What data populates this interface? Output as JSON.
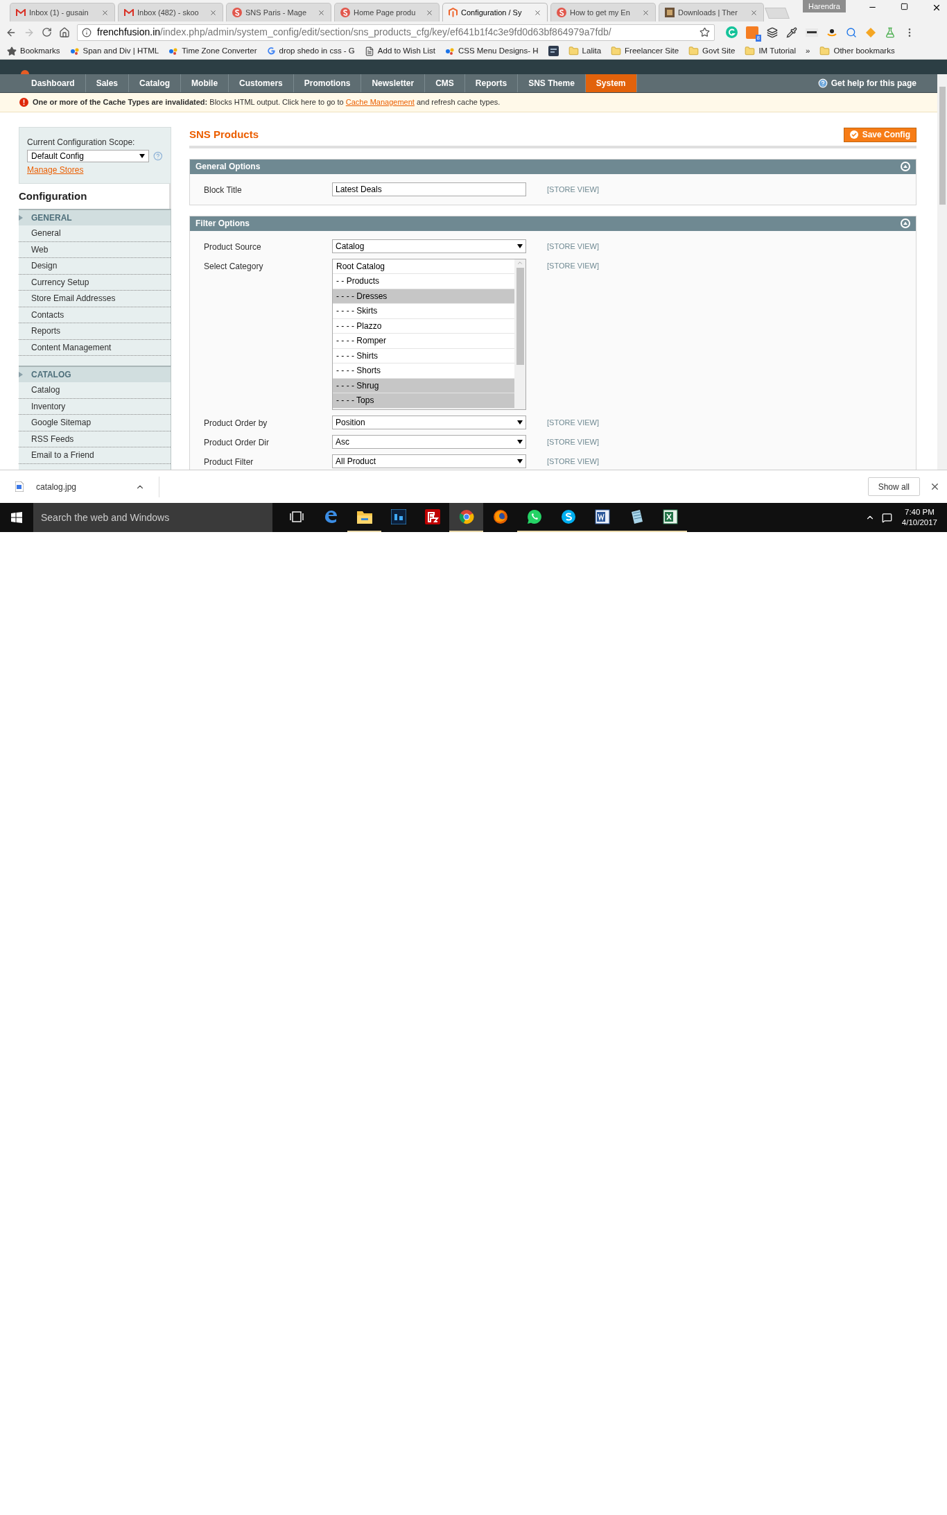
{
  "browser": {
    "tabs": [
      {
        "kind": "gmail",
        "title": "Inbox (1) - gusain",
        "selected": false
      },
      {
        "kind": "gmail",
        "title": "Inbox (482) - skoo",
        "selected": false
      },
      {
        "kind": "sns",
        "title": "SNS Paris - Mage",
        "selected": false
      },
      {
        "kind": "sns",
        "title": "Home Page produ",
        "selected": false
      },
      {
        "kind": "magento",
        "title": "Configuration / Sy",
        "selected": true
      },
      {
        "kind": "sns",
        "title": "How to get my En",
        "selected": false
      },
      {
        "kind": "image",
        "title": "Downloads | Ther",
        "selected": false
      }
    ],
    "profile": "Harendra",
    "url": {
      "host": "frenchfusion.in",
      "path": "/index.php/admin/system_config/edit/section/sns_products_cfg/key/ef641b1f4c3e9fd0d63bf864979a7fdb/"
    },
    "extension_badge": "8",
    "bookmarks": [
      {
        "kind": "star",
        "label": "Bookmarks"
      },
      {
        "kind": "page",
        "label": "Span and Div | HTML"
      },
      {
        "kind": "page",
        "label": "Time Zone Converter"
      },
      {
        "kind": "google",
        "label": "drop shedo in css - G"
      },
      {
        "kind": "doc",
        "label": "Add to Wish List"
      },
      {
        "kind": "page",
        "label": "CSS Menu Designs- H"
      },
      {
        "kind": "app"
      },
      {
        "kind": "folder",
        "label": "Lalita"
      },
      {
        "kind": "folder",
        "label": "Freelancer Site"
      },
      {
        "kind": "folder",
        "label": "Govt Site"
      },
      {
        "kind": "folder",
        "label": "IM Tutorial"
      },
      {
        "kind": "more",
        "label": "»"
      },
      {
        "kind": "folder",
        "label": "Other bookmarks"
      }
    ]
  },
  "nav": {
    "items": [
      {
        "label": "Dashboard",
        "selected": false
      },
      {
        "label": "Sales",
        "selected": false
      },
      {
        "label": "Catalog",
        "selected": false
      },
      {
        "label": "Mobile",
        "selected": false
      },
      {
        "label": "Customers",
        "selected": false
      },
      {
        "label": "Promotions",
        "selected": false
      },
      {
        "label": "Newsletter",
        "selected": false
      },
      {
        "label": "CMS",
        "selected": false
      },
      {
        "label": "Reports",
        "selected": false
      },
      {
        "label": "SNS Theme",
        "selected": false
      },
      {
        "label": "System",
        "selected": true
      }
    ],
    "help": "Get help for this page"
  },
  "alert": {
    "text": "**One or more of the Cache Types are invalidated:** Blocks HTML output. Click here to go to",
    "link": "Cache Management",
    "after": "and refresh cache types."
  },
  "sidebar": {
    "scope_label": "Current Configuration Scope:",
    "scope_value": "Default Config",
    "manage_link": "Manage Stores",
    "heading": "Configuration",
    "sections": [
      {
        "title": "GENERAL",
        "items": [
          "General",
          "Web",
          "Design",
          "Currency Setup",
          "Store Email Addresses",
          "Contacts",
          "Reports",
          "Content Management"
        ]
      },
      {
        "title": "CATALOG",
        "items": [
          "Catalog",
          "Inventory",
          "Google Sitemap",
          "RSS Feeds",
          "Email to a Friend"
        ]
      }
    ]
  },
  "main": {
    "title": "SNS Products",
    "save_button": "Save Config",
    "groups": [
      {
        "title": "General Options",
        "expanded": true,
        "rows": [
          {
            "kind": "text",
            "label": "Block Title",
            "value": "Latest Deals",
            "scope": "[STORE VIEW]"
          }
        ]
      },
      {
        "title": "Filter Options",
        "expanded": true,
        "rows": [
          {
            "kind": "select",
            "label": "Product Source",
            "value": "Catalog",
            "scope": "[STORE VIEW]"
          },
          {
            "kind": "multiselect",
            "label": "Select Category",
            "scope": "[STORE VIEW]",
            "options": [
              {
                "label": "Root Catalog",
                "selected": false
              },
              {
                "label": "- - Products",
                "selected": false
              },
              {
                "label": "- - - - Dresses",
                "selected": true
              },
              {
                "label": "- - - - Skirts",
                "selected": false
              },
              {
                "label": "- - - - Plazzo",
                "selected": false
              },
              {
                "label": "- - - - Romper",
                "selected": false
              },
              {
                "label": "- - - - Shirts",
                "selected": false
              },
              {
                "label": "- - - - Shorts",
                "selected": false
              },
              {
                "label": "- - - - Shrug",
                "selected": true
              },
              {
                "label": "- - - - Tops",
                "selected": true
              }
            ]
          },
          {
            "kind": "select",
            "label": "Product Order by",
            "value": "Position",
            "scope": "[STORE VIEW]"
          },
          {
            "kind": "select",
            "label": "Product Order Dir",
            "value": "Asc",
            "scope": "[STORE VIEW]"
          },
          {
            "kind": "select",
            "label": "Product Filter",
            "value": "All Product",
            "scope": "[STORE VIEW]"
          }
        ]
      }
    ]
  },
  "downloads": {
    "file": "catalog.jpg",
    "show_all": "Show all"
  },
  "taskbar": {
    "search_placeholder": "Search the web and Windows",
    "apps": [
      {
        "kind": "taskview",
        "running": false,
        "selected": false
      },
      {
        "kind": "edge",
        "running": false,
        "selected": false
      },
      {
        "kind": "explorer",
        "running": true,
        "selected": false
      },
      {
        "kind": "photoshop",
        "running": false,
        "selected": false
      },
      {
        "kind": "filezilla",
        "running": false,
        "selected": false
      },
      {
        "kind": "chrome",
        "running": true,
        "selected": true
      },
      {
        "kind": "firefox",
        "running": false,
        "selected": false
      },
      {
        "kind": "whatsapp",
        "running": true,
        "selected": false
      },
      {
        "kind": "skype",
        "running": true,
        "selected": false
      },
      {
        "kind": "word",
        "running": true,
        "selected": false
      },
      {
        "kind": "notepad",
        "running": true,
        "selected": false
      },
      {
        "kind": "excel",
        "running": true,
        "selected": false
      }
    ],
    "time": "7:40 PM",
    "date": "4/10/2017"
  }
}
